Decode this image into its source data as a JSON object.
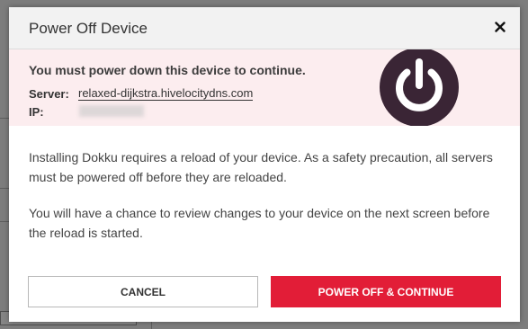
{
  "modal": {
    "title": "Power Off Device",
    "close_label": "×"
  },
  "alert": {
    "heading": "You must power down this device to continue.",
    "server_label": "Server:",
    "server_value": "relaxed-dijkstra.hivelocitydns.com",
    "ip_label": "IP:",
    "ip_value": ""
  },
  "body": {
    "paragraph1": "Installing Dokku requires a reload of your device. As a safety precaution, all servers must be powered off before they are reloaded.",
    "paragraph2": "You will have a chance to review changes to your device on the next screen before the reload is started."
  },
  "buttons": {
    "cancel": "CANCEL",
    "confirm": "POWER OFF & CONTINUE"
  },
  "colors": {
    "accent": "#e21d37",
    "alert_bg": "#fcedef",
    "icon_dark": "#3a2535"
  },
  "icons": [
    "close-icon",
    "power-icon"
  ]
}
